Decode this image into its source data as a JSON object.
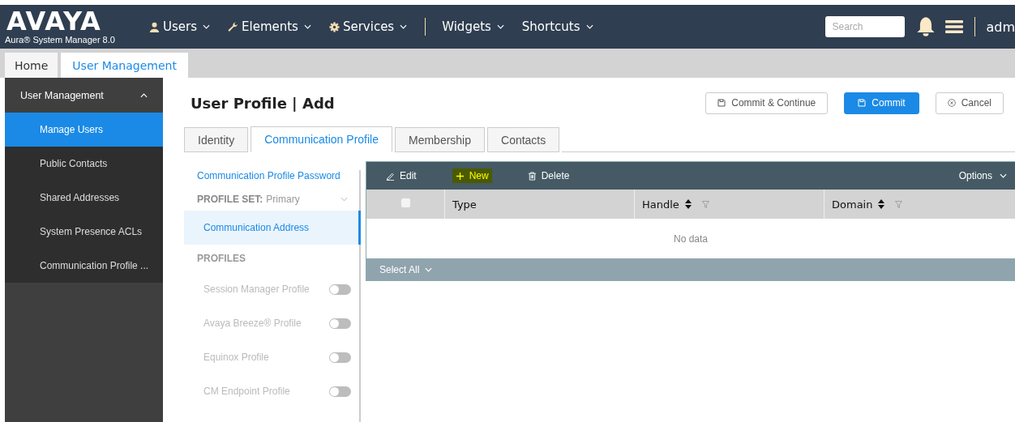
{
  "header": {
    "logo": "AVAYA",
    "subtitle": "Aura® System Manager 8.0",
    "menus": [
      {
        "label": "Users",
        "kind": "user"
      },
      {
        "label": "Elements",
        "kind": "wrench"
      },
      {
        "label": "Services",
        "kind": "gear"
      },
      {
        "label": "Widgets",
        "kind": "plain"
      },
      {
        "label": "Shortcuts",
        "kind": "plain"
      }
    ],
    "search": {
      "placeholder": "Search"
    },
    "user": "adm"
  },
  "page_tabs": [
    {
      "label": "Home",
      "selected": false
    },
    {
      "label": "User Management",
      "selected": true
    }
  ],
  "sidebar": {
    "title": "User Management",
    "expanded": true,
    "items": [
      {
        "label": "Manage Users",
        "selected": true
      },
      {
        "label": "Public Contacts",
        "selected": false
      },
      {
        "label": "Shared Addresses",
        "selected": false
      },
      {
        "label": "System Presence ACLs",
        "selected": false
      },
      {
        "label": "Communication Profile ...",
        "selected": false
      }
    ]
  },
  "title": "User Profile | Add",
  "actions": [
    {
      "label": "Commit & Continue",
      "kind": "save",
      "primary": false
    },
    {
      "label": "Commit",
      "kind": "save",
      "primary": true
    },
    {
      "label": "Cancel",
      "kind": "cancel",
      "primary": false
    }
  ],
  "tabs": [
    {
      "label": "Identity",
      "selected": false
    },
    {
      "label": "Communication Profile",
      "selected": true
    },
    {
      "label": "Membership",
      "selected": false
    },
    {
      "label": "Contacts",
      "selected": false
    }
  ],
  "profile_nav": {
    "password_link": "Communication Profile Password",
    "profile_set_label": "PROFILE SET:",
    "profile_set_value": "Primary",
    "address": {
      "label": "Communication Address",
      "selected": true
    },
    "profiles_heading": "PROFILES",
    "profiles": [
      {
        "label": "Session Manager Profile",
        "on": false
      },
      {
        "label": "Avaya Breeze® Profile",
        "on": false
      },
      {
        "label": "Equinox Profile",
        "on": false
      },
      {
        "label": "CM Endpoint Profile",
        "on": false
      }
    ]
  },
  "table": {
    "toolbar": [
      {
        "label": "Edit",
        "kind": "edit",
        "highlighted": false
      },
      {
        "label": "New",
        "kind": "new",
        "highlighted": true
      },
      {
        "label": "Delete",
        "kind": "delete",
        "highlighted": false
      }
    ],
    "options": "Options",
    "select_all_checked": false,
    "columns": [
      {
        "label": "Type",
        "sortable": false
      },
      {
        "label": "Handle",
        "sortable": true
      },
      {
        "label": "Domain",
        "sortable": true
      }
    ],
    "empty": "No data",
    "footer": "Select All"
  }
}
